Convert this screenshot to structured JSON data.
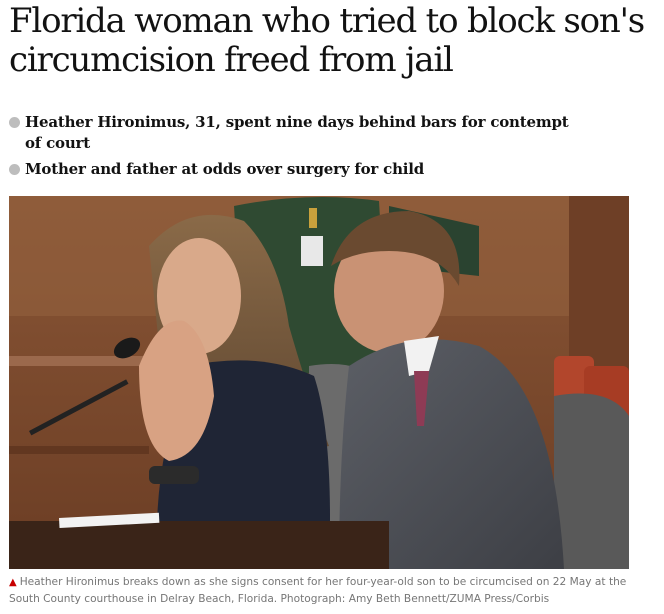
{
  "article": {
    "headline": "Florida woman who tried to block son's circumcision freed from jail",
    "bullets": [
      "Heather Hironimus, 31, spent nine days behind bars for contempt of court",
      "Mother and father at odds over surgery for child"
    ],
    "photo": {
      "caption": "Heather Hironimus breaks down as she signs consent for her four-year-old son to be circumcised on 22 May at the South County courthouse in Delray Beach, Florida. Photograph: Amy Beth Bennett/ZUMA Press/Corbis",
      "caption_marker": "▲"
    }
  },
  "colors": {
    "headline": "#121212",
    "bullet_dot": "#bdbdbd",
    "caption_text": "#767676",
    "caption_marker": "#c70000"
  }
}
